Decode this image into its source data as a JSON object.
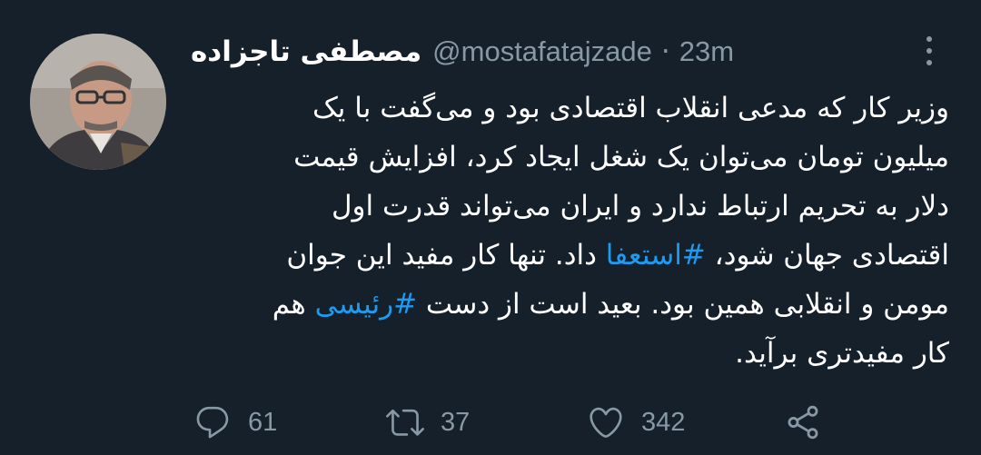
{
  "tweet": {
    "author_name": "مصطفی تاجزاده",
    "handle": "@mostafatajzade",
    "separator": "·",
    "time": "23m",
    "lines": [
      [
        {
          "t": "وزیر کار که مدعی انقلاب اقتصادی بود و می‌گفت با یک"
        }
      ],
      [
        {
          "t": "میلیون تومان می‌توان یک شغل ایجاد کرد، افزایش قیمت"
        }
      ],
      [
        {
          "t": "دلار به تحریم ارتباط ندارد و ایران می‌تواند قدرت اول"
        }
      ],
      [
        {
          "t": "اقتصادی جهان شود، "
        },
        {
          "h": "#استعفا"
        },
        {
          "t": " داد. تنها کار مفید این جوان"
        }
      ],
      [
        {
          "t": "مومن و انقلابی همین بود. بعید است از دست "
        },
        {
          "h": "#رئیسی"
        },
        {
          "t": " هم"
        }
      ],
      [
        {
          "t": "کار مفیدتری برآید."
        }
      ]
    ]
  },
  "actions": {
    "reply_count": "61",
    "retweet_count": "37",
    "like_count": "342"
  },
  "icons": {
    "more": "more-vertical-icon",
    "reply": "reply-icon",
    "retweet": "retweet-icon",
    "like": "heart-icon",
    "share": "share-icon"
  },
  "colors": {
    "background": "#15202b",
    "text": "#ffffff",
    "secondary": "#8899a6",
    "link": "#1d9bf0"
  }
}
